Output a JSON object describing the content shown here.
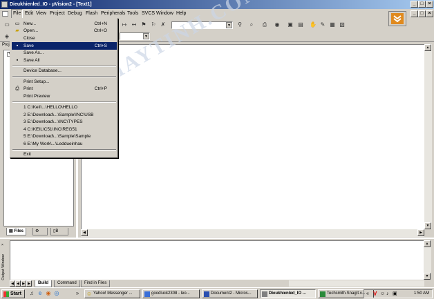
{
  "window": {
    "title": "Dieukhienled_IO - µVision2 - [Text1]"
  },
  "menubar": {
    "items": [
      "File",
      "Edit",
      "View",
      "Project",
      "Debug",
      "Flash",
      "Peripherals",
      "Tools",
      "SVCS",
      "Window",
      "Help"
    ]
  },
  "file_menu": {
    "items": [
      {
        "label": "New...",
        "shortcut": "Ctrl+N",
        "icon": "new-file-icon"
      },
      {
        "label": "Open...",
        "shortcut": "Ctrl+O",
        "icon": "open-folder-icon"
      },
      {
        "label": "Close",
        "shortcut": ""
      },
      {
        "label": "Save",
        "shortcut": "Ctrl+S",
        "icon": "save-disk-icon",
        "selected": true
      },
      {
        "label": "Save As...",
        "shortcut": ""
      },
      {
        "label": "Save All",
        "shortcut": "",
        "icon": "save-all-icon"
      },
      {
        "label": "Device Database...",
        "shortcut": ""
      },
      {
        "label": "Print Setup...",
        "shortcut": ""
      },
      {
        "label": "Print",
        "shortcut": "Ctrl+P",
        "icon": "printer-icon"
      },
      {
        "label": "Print Preview",
        "shortcut": ""
      },
      {
        "label": "1 C:\\Keil\\...\\HELLO\\HELLO",
        "shortcut": ""
      },
      {
        "label": "2 E:\\Download\\...\\Sample\\INC\\USB",
        "shortcut": ""
      },
      {
        "label": "3 E:\\Download\\...\\INC\\TYPES",
        "shortcut": ""
      },
      {
        "label": "4 C:\\KEIL\\C51\\INC\\REG51",
        "shortcut": ""
      },
      {
        "label": "5 E:\\Download\\...\\Sample\\Sample",
        "shortcut": ""
      },
      {
        "label": "6 E:\\My Work\\...\\Leddueinhau",
        "shortcut": ""
      },
      {
        "label": "Exit",
        "shortcut": ""
      }
    ]
  },
  "left_panel": {
    "header": "Proj",
    "tabs": [
      "Files",
      "",
      "B"
    ]
  },
  "output": {
    "side_label": "Output Window",
    "tabs": [
      "Build",
      "Command",
      "Find in Files"
    ]
  },
  "taskbar": {
    "start_label": "Start",
    "buttons": [
      "Yahoo! Messenger ...",
      "goodluck2308 - leo...",
      "Document2 - Micros...",
      "Dieukhienled_IO ...",
      "Techsmith.SnagIt.v..."
    ],
    "clock": "1:50 AM"
  },
  "watermark": "DIENTUMAYTINH.COM",
  "colors": {
    "titlebar_start": "#0a246a",
    "titlebar_end": "#a6caf0",
    "face": "#d4d0c8",
    "highlight": "#0a246a"
  }
}
